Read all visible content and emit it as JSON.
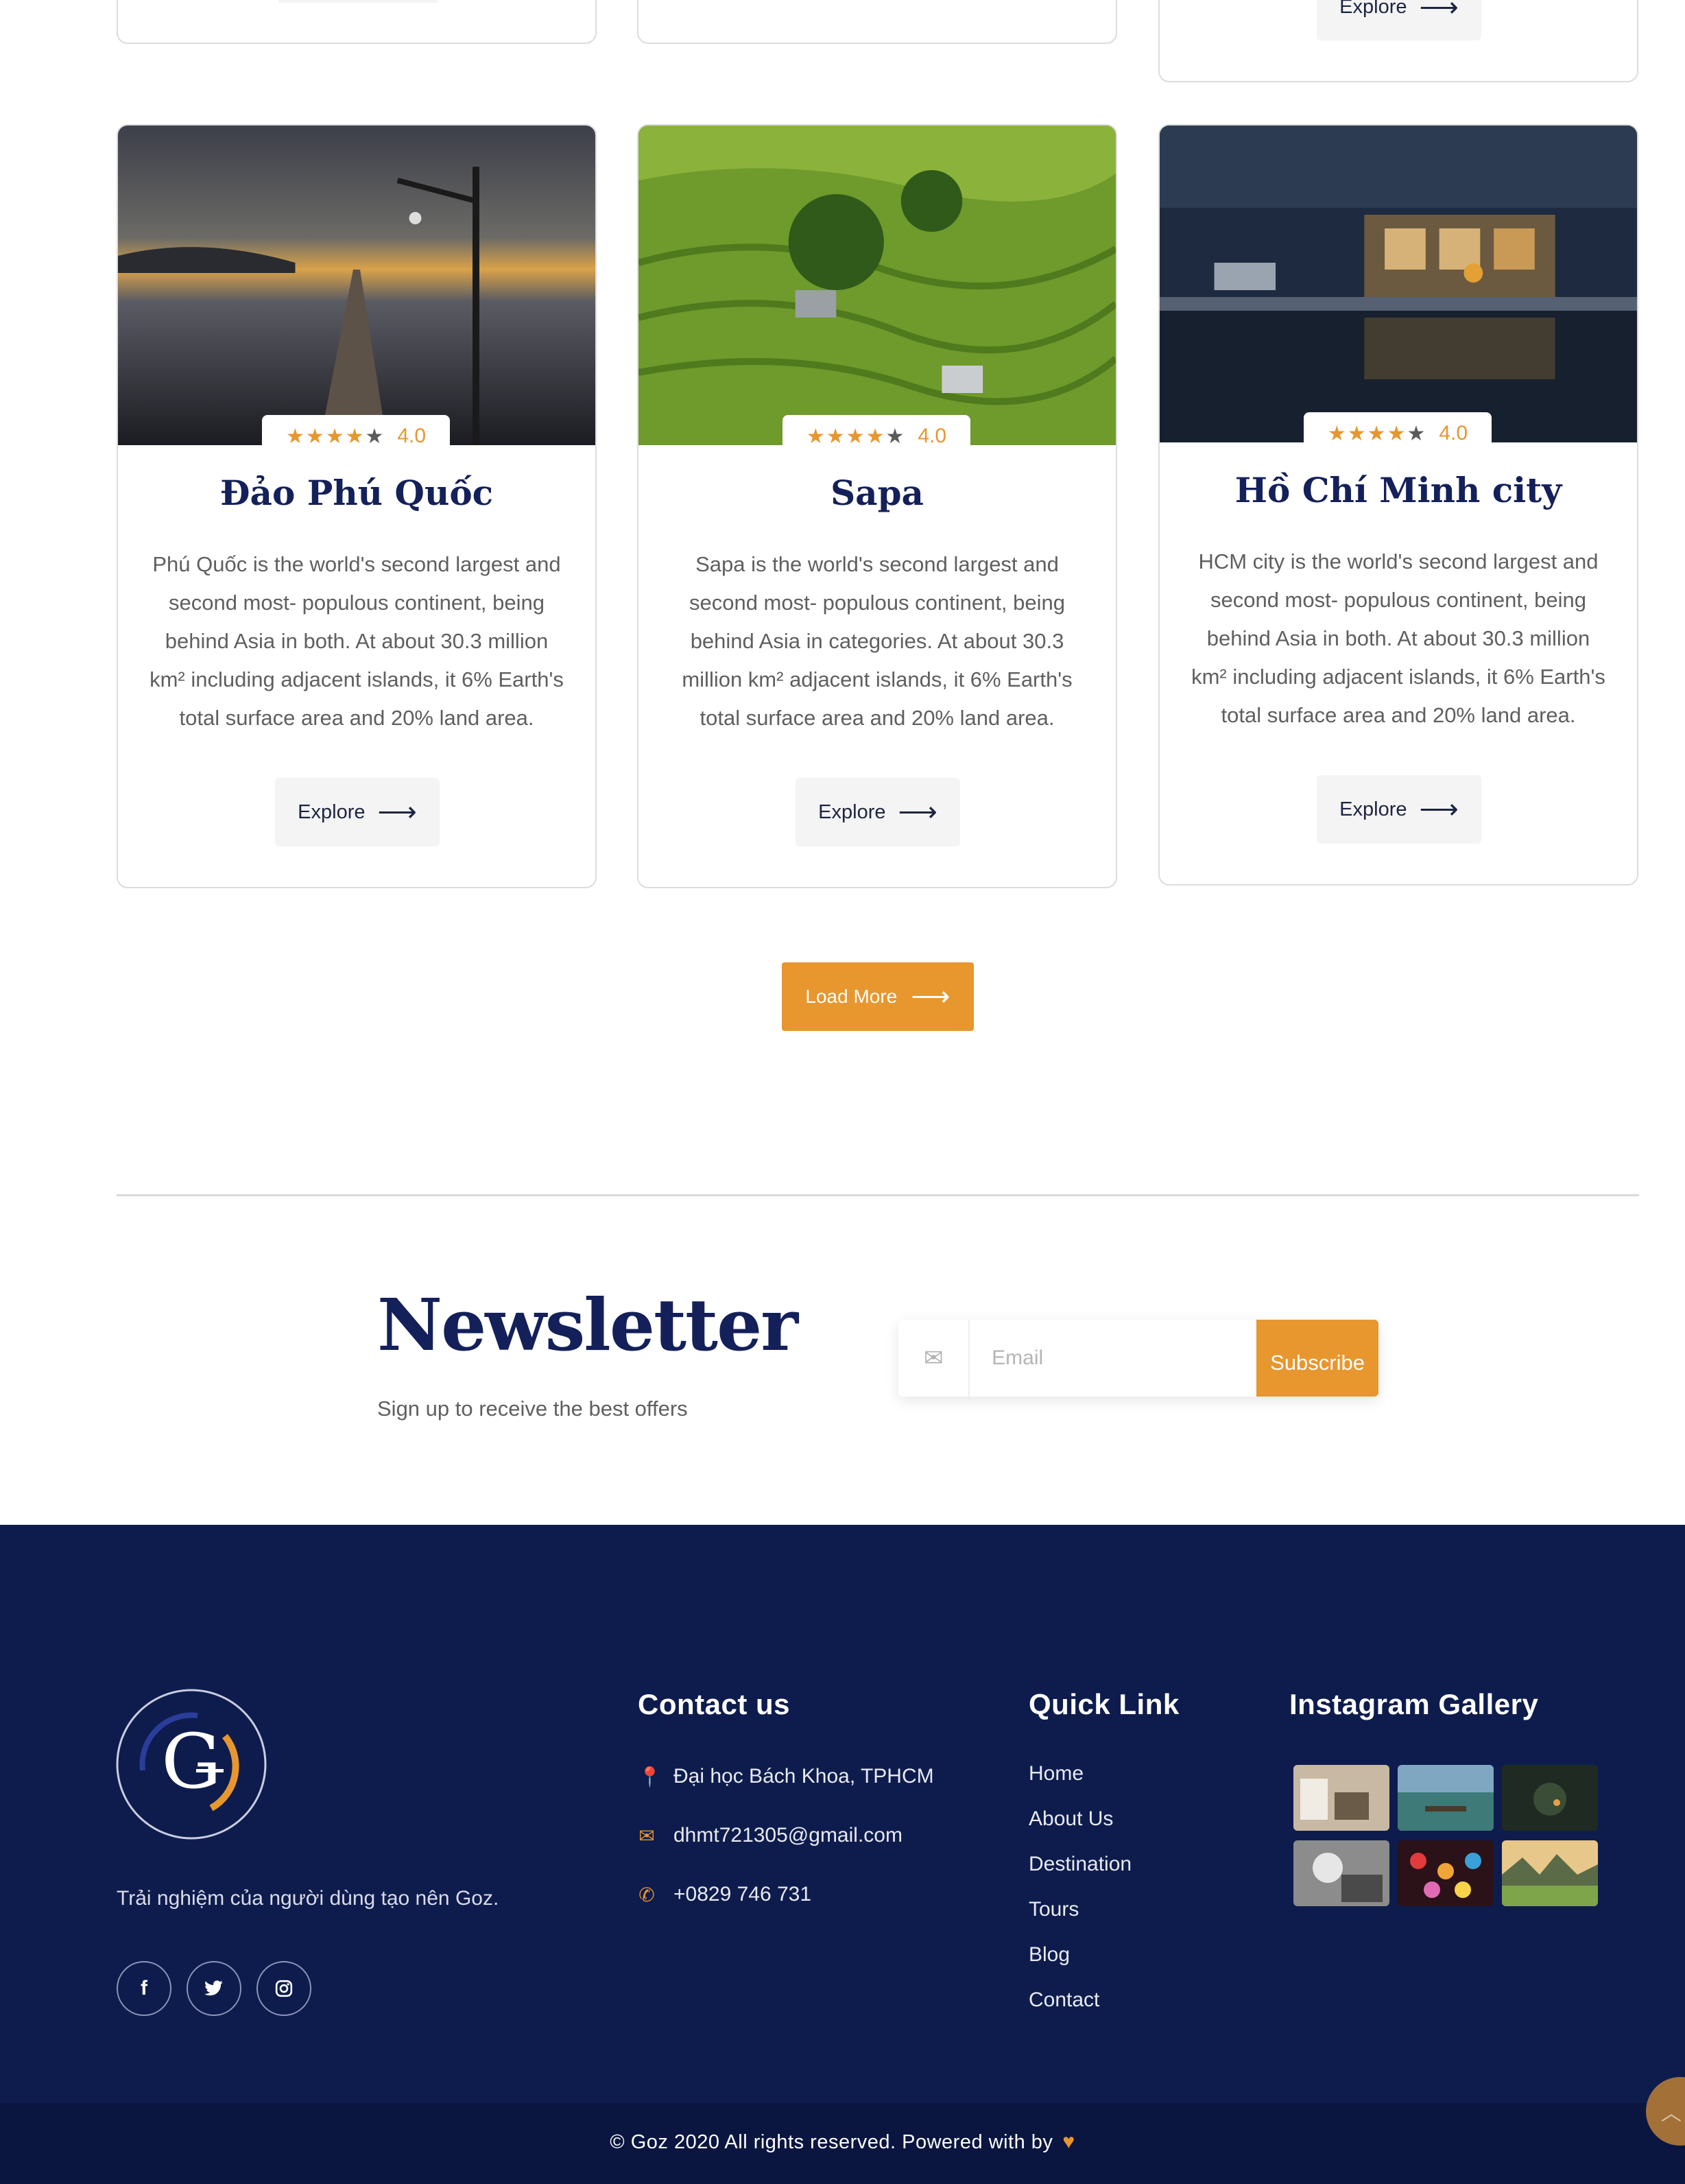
{
  "top_partial": {
    "explore_label": "Explore"
  },
  "cards": [
    {
      "title": "Đảo Phú Quốc",
      "description": "Phú Quốc is the world's second largest and second most- populous continent, being behind Asia in both. At about 30.3 million km² including adjacent islands, it 6% Earth's total surface area and 20% land area.",
      "rating": "4.0",
      "stars_filled": 4,
      "stars_total": 5,
      "explore_label": "Explore"
    },
    {
      "title": "Sapa",
      "description": "Sapa is the world's second largest and second most- populous continent, being behind Asia in categories. At about 30.3 million km² adjacent islands, it 6% Earth's total surface area and 20% land area.",
      "rating": "4.0",
      "stars_filled": 4,
      "stars_total": 5,
      "explore_label": "Explore"
    },
    {
      "title": "Hồ Chí Minh city",
      "description": "HCM city is the world's second largest and second most- populous continent, being behind Asia in both. At about 30.3 million km² including adjacent islands, it 6% Earth's total surface area and 20% land area.",
      "rating": "4.0",
      "stars_filled": 4,
      "stars_total": 5,
      "explore_label": "Explore"
    }
  ],
  "load_more": "Load More",
  "newsletter": {
    "title": "Newsletter",
    "subtitle": "Sign up to receive the best offers",
    "email_placeholder": "Email",
    "subscribe_label": "Subscribe"
  },
  "footer": {
    "logo_letter": "G",
    "tagline": "Trải nghiệm của người dùng tạo nên Goz.",
    "socials": [
      "f",
      "t",
      "ig"
    ],
    "contact": {
      "heading": "Contact us",
      "address": "Đại học Bách Khoa, TPHCM",
      "email": "dhmt721305@gmail.com",
      "phone": "+0829 746 731"
    },
    "quick_link": {
      "heading": "Quick Link",
      "items": [
        "Home",
        "About Us",
        "Destination",
        "Tours",
        "Blog",
        "Contact"
      ]
    },
    "instagram": {
      "heading": "Instagram Gallery"
    },
    "copyright": "© Goz 2020 All rights reserved. Powered with by"
  },
  "colors": {
    "accent": "#e8962e",
    "navy": "#14205a",
    "footer_bg": "#0e1c4d"
  }
}
